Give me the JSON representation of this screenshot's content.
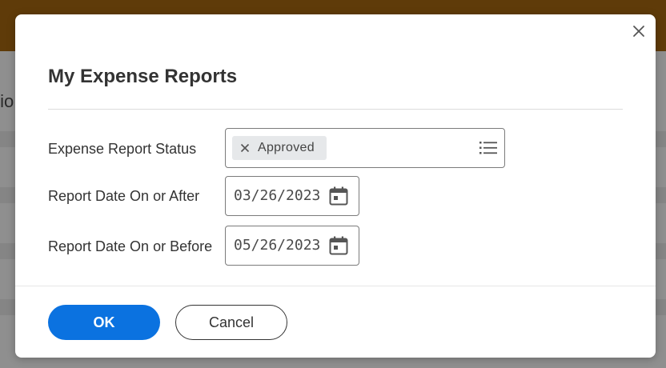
{
  "background": {
    "partial_text": "tio"
  },
  "dialog": {
    "title": "My Expense Reports",
    "close_icon": "close-icon",
    "fields": {
      "status": {
        "label": "Expense Report Status",
        "selected": "Approved",
        "remove_icon": "close-icon",
        "prompt_icon": "list-icon"
      },
      "date_after": {
        "label": "Report Date On or After",
        "value": "03/26/2023",
        "icon": "calendar-icon"
      },
      "date_before": {
        "label": "Report Date On or Before",
        "value": "05/26/2023",
        "icon": "calendar-icon"
      }
    },
    "buttons": {
      "ok": "OK",
      "cancel": "Cancel"
    }
  },
  "colors": {
    "header": "#5f3b09",
    "primary": "#0b72e0"
  }
}
